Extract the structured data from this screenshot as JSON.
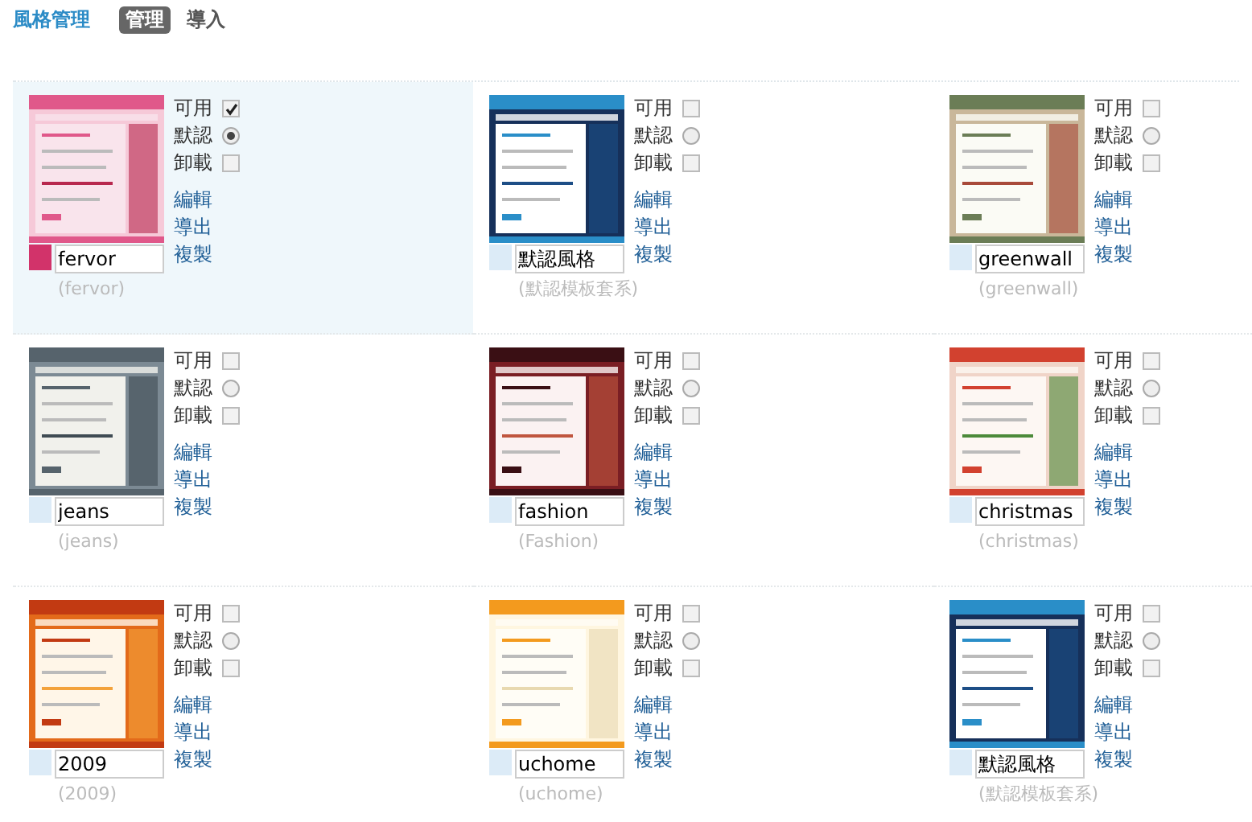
{
  "header": {
    "title": "風格管理",
    "tabs": [
      {
        "label": "管理",
        "selected": true
      },
      {
        "label": "導入",
        "selected": false
      }
    ]
  },
  "styles": [
    {
      "name": "fervor",
      "caption": "(fervor)",
      "color": "#d2336a",
      "selected": true,
      "options": [
        {
          "label": "可用",
          "kind": "checkbox",
          "checked": true
        },
        {
          "label": "默認",
          "kind": "radio",
          "checked": true
        },
        {
          "label": "卸載",
          "kind": "checkbox",
          "checked": false
        }
      ],
      "actions": [
        "編輯",
        "導出",
        "複製"
      ]
    },
    {
      "name": "默認風格",
      "caption": "(默認模板套系)",
      "color": "#dcebf7",
      "selected": false,
      "options": [
        {
          "label": "可用",
          "kind": "checkbox",
          "checked": false
        },
        {
          "label": "默認",
          "kind": "radio",
          "checked": false
        },
        {
          "label": "卸載",
          "kind": "checkbox",
          "checked": false
        }
      ],
      "actions": [
        "編輯",
        "導出",
        "複製"
      ]
    },
    {
      "name": "greenwall",
      "caption": "(greenwall)",
      "color": "#dcebf7",
      "selected": false,
      "options": [
        {
          "label": "可用",
          "kind": "checkbox",
          "checked": false
        },
        {
          "label": "默認",
          "kind": "radio",
          "checked": false
        },
        {
          "label": "卸載",
          "kind": "checkbox",
          "checked": false
        }
      ],
      "actions": [
        "編輯",
        "導出",
        "複製"
      ]
    },
    {
      "name": "jeans",
      "caption": "(jeans)",
      "color": "#dcebf7",
      "selected": false,
      "options": [
        {
          "label": "可用",
          "kind": "checkbox",
          "checked": false
        },
        {
          "label": "默認",
          "kind": "radio",
          "checked": false
        },
        {
          "label": "卸載",
          "kind": "checkbox",
          "checked": false
        }
      ],
      "actions": [
        "編輯",
        "導出",
        "複製"
      ]
    },
    {
      "name": "fashion",
      "caption": "(Fashion)",
      "color": "#dcebf7",
      "selected": false,
      "options": [
        {
          "label": "可用",
          "kind": "checkbox",
          "checked": false
        },
        {
          "label": "默認",
          "kind": "radio",
          "checked": false
        },
        {
          "label": "卸載",
          "kind": "checkbox",
          "checked": false
        }
      ],
      "actions": [
        "編輯",
        "導出",
        "複製"
      ]
    },
    {
      "name": "christmas",
      "caption": "(christmas)",
      "color": "#dcebf7",
      "selected": false,
      "options": [
        {
          "label": "可用",
          "kind": "checkbox",
          "checked": false
        },
        {
          "label": "默認",
          "kind": "radio",
          "checked": false
        },
        {
          "label": "卸載",
          "kind": "checkbox",
          "checked": false
        }
      ],
      "actions": [
        "編輯",
        "導出",
        "複製"
      ]
    },
    {
      "name": "2009",
      "caption": "(2009)",
      "color": "#dcebf7",
      "selected": false,
      "options": [
        {
          "label": "可用",
          "kind": "checkbox",
          "checked": false
        },
        {
          "label": "默認",
          "kind": "radio",
          "checked": false
        },
        {
          "label": "卸載",
          "kind": "checkbox",
          "checked": false
        }
      ],
      "actions": [
        "編輯",
        "導出",
        "複製"
      ]
    },
    {
      "name": "uchome",
      "caption": "(uchome)",
      "color": "#dcebf7",
      "selected": false,
      "options": [
        {
          "label": "可用",
          "kind": "checkbox",
          "checked": false
        },
        {
          "label": "默認",
          "kind": "radio",
          "checked": false
        },
        {
          "label": "卸載",
          "kind": "checkbox",
          "checked": false
        }
      ],
      "actions": [
        "編輯",
        "導出",
        "複製"
      ]
    },
    {
      "name": "默認風格",
      "caption": "(默認模板套系)",
      "color": "#dcebf7",
      "selected": false,
      "options": [
        {
          "label": "可用",
          "kind": "checkbox",
          "checked": false
        },
        {
          "label": "默認",
          "kind": "radio",
          "checked": false
        },
        {
          "label": "卸載",
          "kind": "checkbox",
          "checked": false
        }
      ],
      "actions": [
        "編輯",
        "導出",
        "複製"
      ]
    }
  ]
}
